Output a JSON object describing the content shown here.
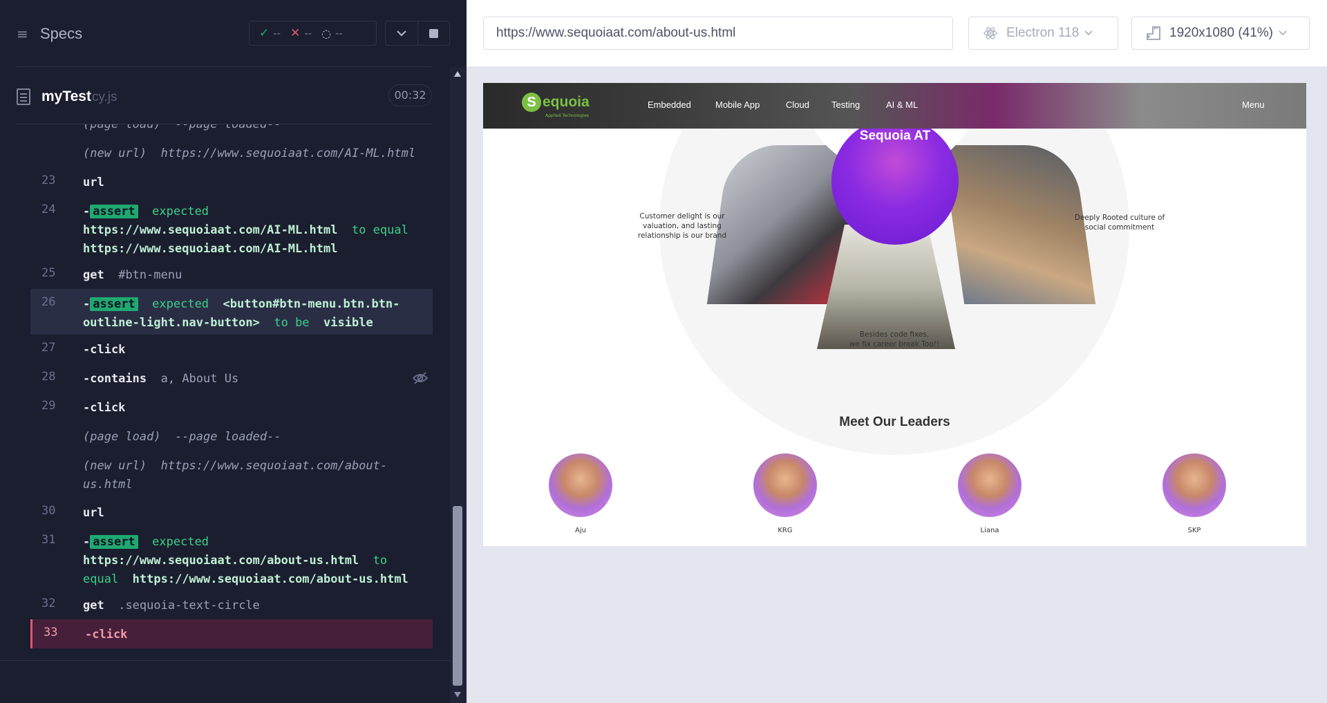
{
  "reporter": {
    "title": "Specs",
    "stats": {
      "passed": "--",
      "failed": "--",
      "pending": "--"
    },
    "spec": {
      "name": "myTest",
      "ext": "cy.js",
      "duration": "00:32"
    }
  },
  "commands": [
    {
      "type": "partial",
      "text_a": "(page load)",
      "text_b": "--page loaded--"
    },
    {
      "type": "info",
      "label": "(new url)",
      "value": "https://www.sequoiaat.com/AI-ML.html"
    },
    {
      "num": "23",
      "name": "url",
      "msg": ""
    },
    {
      "num": "24",
      "badge": "assert",
      "expected": "expected",
      "val_a": "https://www.sequoiaat.com/AI-ML.html",
      "op": "to equal",
      "val_b": "https://www.sequoiaat.com/AI-ML.html"
    },
    {
      "num": "25",
      "name": "get",
      "msg": "#btn-menu"
    },
    {
      "num": "26",
      "badge": "assert",
      "expected": "expected",
      "val_a": "<button#btn-menu.btn.btn-outline-light.nav-button>",
      "op": "to be",
      "val_b": "visible"
    },
    {
      "num": "27",
      "name": "-click",
      "msg": ""
    },
    {
      "num": "28",
      "name": "-contains",
      "msg": "a, About Us"
    },
    {
      "num": "29",
      "name": "-click",
      "msg": ""
    },
    {
      "type": "info",
      "label": "(page load)",
      "value": "--page loaded--"
    },
    {
      "type": "info",
      "label": "(new url)",
      "value": "https://www.sequoiaat.com/about-us.html"
    },
    {
      "num": "30",
      "name": "url",
      "msg": ""
    },
    {
      "num": "31",
      "badge": "assert",
      "expected": "expected",
      "val_a": "https://www.sequoiaat.com/about-us.html",
      "op": "to equal",
      "val_b": "https://www.sequoiaat.com/about-us.html"
    },
    {
      "num": "32",
      "name": "get",
      "msg": ".sequoia-text-circle"
    },
    {
      "num": "33",
      "name": "-click",
      "msg": ""
    }
  ],
  "aut": {
    "url": "https://www.sequoiaat.com/about-us.html",
    "browser": "Electron 118",
    "viewport": "1920x1080 (41%)"
  },
  "site": {
    "logo_text": "equoia",
    "logo_letter": "S",
    "logo_sub": "Applied Technologies",
    "nav": [
      "Embedded",
      "Mobile App",
      "Cloud",
      "Testing",
      "AI & ML"
    ],
    "menu": "Menu",
    "center_label": "Sequoia AT",
    "wheel_left": "Customer delight is our valuation, and lasting relationship is our brand",
    "wheel_right": "Deeply Rooted culture of social commitment",
    "wheel_bottom_1": "Besides code fixes,",
    "wheel_bottom_2": "we fix career break Too!!",
    "leaders_title": "Meet Our Leaders",
    "leaders": [
      "Aju",
      "KRG",
      "Liana",
      "SKP"
    ]
  },
  "colors": {
    "pass": "#1fa971",
    "fail": "#e45770",
    "brand_green": "#7bc043",
    "brand_purple": "#8a2be2"
  }
}
